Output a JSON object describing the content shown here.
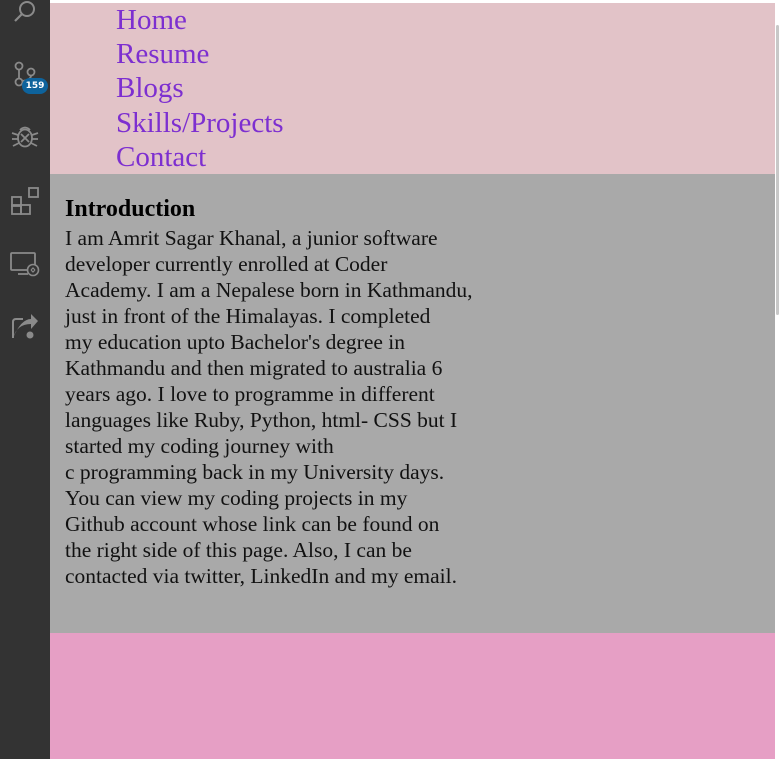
{
  "activity_bar": {
    "icons": [
      "search-icon",
      "source-control-icon",
      "debug-icon",
      "extensions-icon",
      "remote-explorer-icon",
      "live-share-icon"
    ],
    "source_control_badge": "159"
  },
  "nav": {
    "items": [
      {
        "label": "Home"
      },
      {
        "label": "Resume"
      },
      {
        "label": "Blogs"
      },
      {
        "label": "Skills/Projects"
      },
      {
        "label": "Contact"
      }
    ]
  },
  "intro": {
    "heading": "Introduction",
    "lines": [
      "I am Amrit Sagar Khanal, a junior software",
      "developer currently enrolled at Coder",
      "Academy. I am a Nepalese born in Kathmandu,",
      "just in front of the Himalayas. I completed",
      "my education upto Bachelor's degree in",
      "Kathmandu and then migrated to australia 6",
      "years ago. I love to programme in different",
      "languages like Ruby, Python, html- CSS but I",
      "started my coding journey with",
      "c programming back in my University days.",
      "You can view my coding projects in my",
      "Github account whose link can be found on",
      "the right side of this page. Also, I can be",
      "contacted via twitter, LinkedIn and my email."
    ]
  },
  "colors": {
    "nav_bg": "#e2c3c8",
    "link": "#7d2fd0",
    "intro_bg": "#a9a9a9",
    "page_bg": "#e69fc5",
    "activity_bar": "#333333",
    "badge": "#0e639c"
  }
}
